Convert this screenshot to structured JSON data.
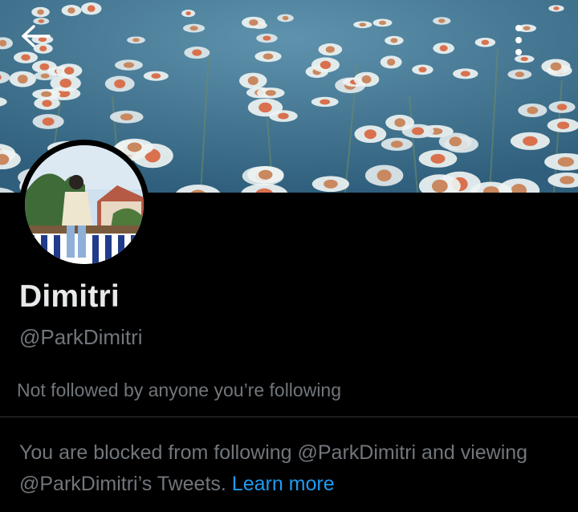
{
  "header": {
    "back_icon": "arrow-left-icon",
    "more_icon": "more-vertical-icon"
  },
  "profile": {
    "display_name": "Dimitri",
    "handle": "@ParkDimitri",
    "followers_note": "Not followed by anyone you’re following"
  },
  "blocked_notice": {
    "message": "You are blocked from following @ParkDimitri and viewing @ParkDimitri’s Tweets.",
    "link_label": "Learn more"
  },
  "colors": {
    "background": "#000000",
    "primary_text": "#e7e9ea",
    "secondary_text": "#71767b",
    "link": "#1d9bf0",
    "divider": "#2f3336"
  }
}
